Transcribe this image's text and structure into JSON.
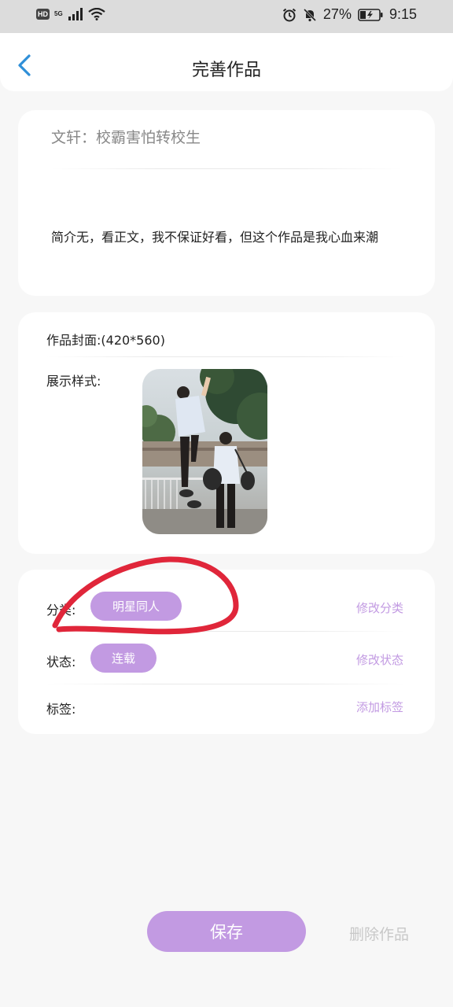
{
  "status_bar": {
    "hd": "HD",
    "network": "5G",
    "battery": "27%",
    "time": "9:15"
  },
  "header": {
    "title": "完善作品"
  },
  "work": {
    "title": "文轩：校霸害怕转校生",
    "intro": "简介无，看正文，我不保证好看，但这个作品是我心血来潮"
  },
  "cover": {
    "label": "作品封面:(420*560)",
    "style_label": "展示样式:"
  },
  "meta": {
    "category_label": "分类:",
    "category_value": "明星同人",
    "category_action": "修改分类",
    "status_label": "状态:",
    "status_value": "连载",
    "status_action": "修改状态",
    "tags_label": "标签:",
    "tags_action": "添加标签"
  },
  "footer": {
    "save": "保存",
    "delete": "删除作品"
  },
  "colors": {
    "accent": "#c29ae2",
    "back_arrow": "#2f8fd8",
    "annotation": "#e0263a"
  }
}
